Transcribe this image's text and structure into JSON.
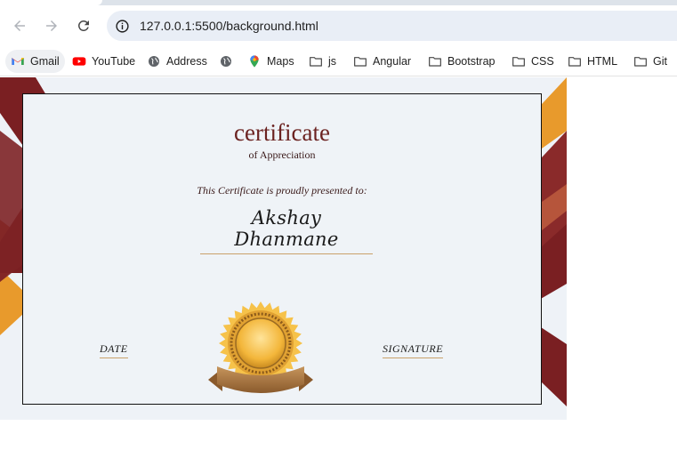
{
  "browser": {
    "url": "127.0.0.1:5500/background.html",
    "bookmarks": [
      {
        "label": "Gmail",
        "icon": "gmail-icon"
      },
      {
        "label": "YouTube",
        "icon": "youtube-icon"
      },
      {
        "label": "Address",
        "icon": "globe-icon"
      },
      {
        "label": "",
        "icon": "globe-icon"
      },
      {
        "label": "Maps",
        "icon": "maps-icon"
      },
      {
        "label": "js",
        "icon": "folder-icon"
      },
      {
        "label": "Angular",
        "icon": "folder-icon"
      },
      {
        "label": "Bootstrap",
        "icon": "folder-icon"
      },
      {
        "label": "CSS",
        "icon": "folder-icon"
      },
      {
        "label": "HTML",
        "icon": "folder-icon"
      },
      {
        "label": "Git",
        "icon": "folder-icon"
      }
    ]
  },
  "certificate": {
    "title": "certificate",
    "subtitle": "of Appreciation",
    "presented_text": "This Certificate is proudly presented to:",
    "recipient_name": "Akshay Dhanmane",
    "date_label": "DATE",
    "signature_label": "SIGNATURE",
    "colors": {
      "maroon": "#7a1f22",
      "orange": "#e89a2c",
      "rust": "#b6553b",
      "gold": "#f2b63c"
    }
  }
}
